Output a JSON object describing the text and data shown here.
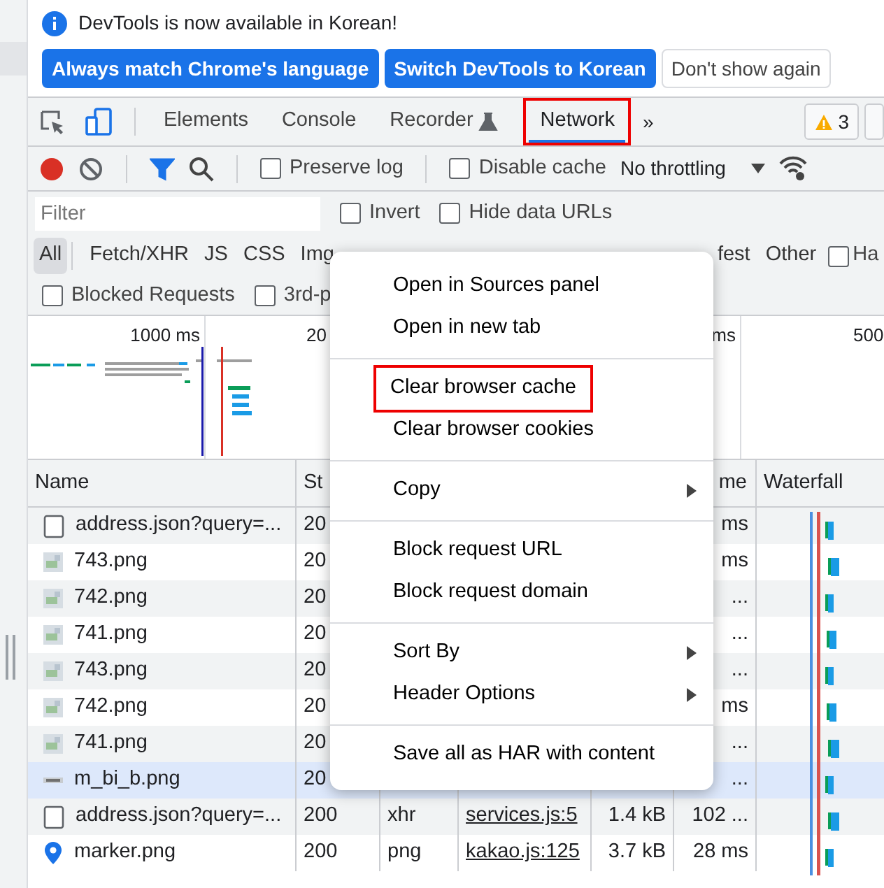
{
  "infobar": {
    "message": "DevTools is now available in Korean!",
    "buttons": [
      {
        "label": "Always match Chrome's language",
        "kind": "primary"
      },
      {
        "label": "Switch DevTools to Korean",
        "kind": "primary"
      },
      {
        "label": "Don't show again",
        "kind": "plain"
      }
    ]
  },
  "tabs": [
    {
      "label": "Elements",
      "kind": "plain",
      "selected": false,
      "highlighted": false
    },
    {
      "label": "Console",
      "kind": "plain",
      "selected": false,
      "highlighted": false
    },
    {
      "label": "Recorder",
      "kind": "experiment",
      "selected": false,
      "highlighted": false
    },
    {
      "label": "Network",
      "kind": "plain",
      "selected": true,
      "highlighted": true
    }
  ],
  "more_tabs": "»",
  "issues_count": "3",
  "toolbar": {
    "recording": true,
    "filter_on": true,
    "checkboxes": [
      {
        "label": "Preserve log",
        "checked": false
      },
      {
        "label": "Disable cache",
        "checked": false
      }
    ],
    "throttling": "No throttling"
  },
  "filter": {
    "placeholder": "Filter",
    "checkboxes": [
      {
        "label": "Invert",
        "checked": false
      },
      {
        "label": "Hide data URLs",
        "checked": false
      }
    ]
  },
  "type_filters": [
    {
      "label": "All",
      "selected": true
    },
    {
      "label": "Fetch/XHR",
      "selected": false
    },
    {
      "label": "JS",
      "selected": false
    },
    {
      "label": "CSS",
      "selected": false
    },
    {
      "label": "Img",
      "selected": false
    },
    {
      "label": "fest",
      "selected": false
    },
    {
      "label": "Other",
      "selected": false
    }
  ],
  "type_row_checkbox": {
    "label": "Ha",
    "checked": false
  },
  "blocked_row": [
    {
      "label": "Blocked Requests",
      "checked": false
    },
    {
      "label": "3rd-p",
      "checked": false
    }
  ],
  "overview": {
    "ticks": [
      "1000 ms",
      "20",
      "ms",
      "500"
    ]
  },
  "table": {
    "columns": {
      "name": "Name",
      "status": "St",
      "time": "me",
      "waterfall": "Waterfall"
    },
    "rows": [
      {
        "name": "address.json?query=...",
        "kind": "document",
        "status": "20",
        "time": "ms",
        "highlighted": false
      },
      {
        "name": "743.png",
        "kind": "image",
        "status": "20",
        "time": "ms",
        "highlighted": false
      },
      {
        "name": "742.png",
        "kind": "image",
        "status": "20",
        "time": "...",
        "highlighted": false
      },
      {
        "name": "741.png",
        "kind": "image",
        "status": "20",
        "time": "...",
        "highlighted": false
      },
      {
        "name": "743.png",
        "kind": "image",
        "status": "20",
        "time": "...",
        "highlighted": false
      },
      {
        "name": "742.png",
        "kind": "image",
        "status": "20",
        "time": "ms",
        "highlighted": false
      },
      {
        "name": "741.png",
        "kind": "image",
        "status": "20",
        "time": "...",
        "highlighted": false
      },
      {
        "name": "m_bi_b.png",
        "kind": "banner",
        "status": "20",
        "time": "...",
        "highlighted": true
      },
      {
        "name": "address.json?query=...",
        "kind": "document",
        "status": "200",
        "type": "xhr",
        "initiator": "services.js:5",
        "size": "1.4 kB",
        "time": "102 ...",
        "highlighted": false
      },
      {
        "name": "marker.png",
        "kind": "marker",
        "status": "200",
        "type": "png",
        "initiator": "kakao.js:125",
        "size": "3.7 kB",
        "time": "28 ms",
        "highlighted": false
      }
    ]
  },
  "context_menu": [
    {
      "kind": "item",
      "label": "Open in Sources panel",
      "highlighted": false
    },
    {
      "kind": "item",
      "label": "Open in new tab",
      "highlighted": false
    },
    {
      "kind": "separator"
    },
    {
      "kind": "item",
      "label": "Clear browser cache",
      "highlighted": true
    },
    {
      "kind": "item",
      "label": "Clear browser cookies",
      "highlighted": false
    },
    {
      "kind": "separator"
    },
    {
      "kind": "submenu",
      "label": "Copy",
      "highlighted": false
    },
    {
      "kind": "separator"
    },
    {
      "kind": "item",
      "label": "Block request URL",
      "highlighted": false
    },
    {
      "kind": "item",
      "label": "Block request domain",
      "highlighted": false
    },
    {
      "kind": "separator"
    },
    {
      "kind": "submenu",
      "label": "Sort By",
      "highlighted": false
    },
    {
      "kind": "submenu",
      "label": "Header Options",
      "highlighted": false
    },
    {
      "kind": "separator"
    },
    {
      "kind": "item",
      "label": "Save all as HAR with content",
      "highlighted": false
    }
  ]
}
